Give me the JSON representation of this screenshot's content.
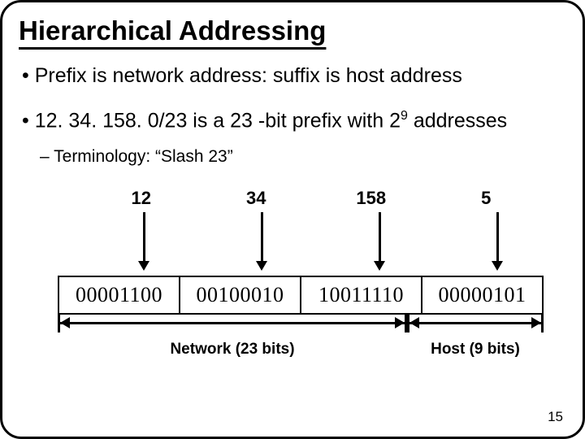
{
  "title": "Hierarchical Addressing",
  "bullets": {
    "b1": "• Prefix is network address: suffix is host address",
    "b2a": "• 12. 34. 158. 0/23 is a 23 -bit prefix with 2",
    "b2_exp": "9",
    "b2b": " addresses",
    "sub": "– Terminology: “Slash 23”"
  },
  "decimal": {
    "o1": "12",
    "o2": "34",
    "o3": "158",
    "o4": "5"
  },
  "binary": {
    "o1": "00001100",
    "o2": "00100010",
    "o3": "10011110",
    "o4": "00000101"
  },
  "ranges": {
    "network_label": "Network (23 bits)",
    "host_label": "Host (9 bits)"
  },
  "page_number": "15"
}
